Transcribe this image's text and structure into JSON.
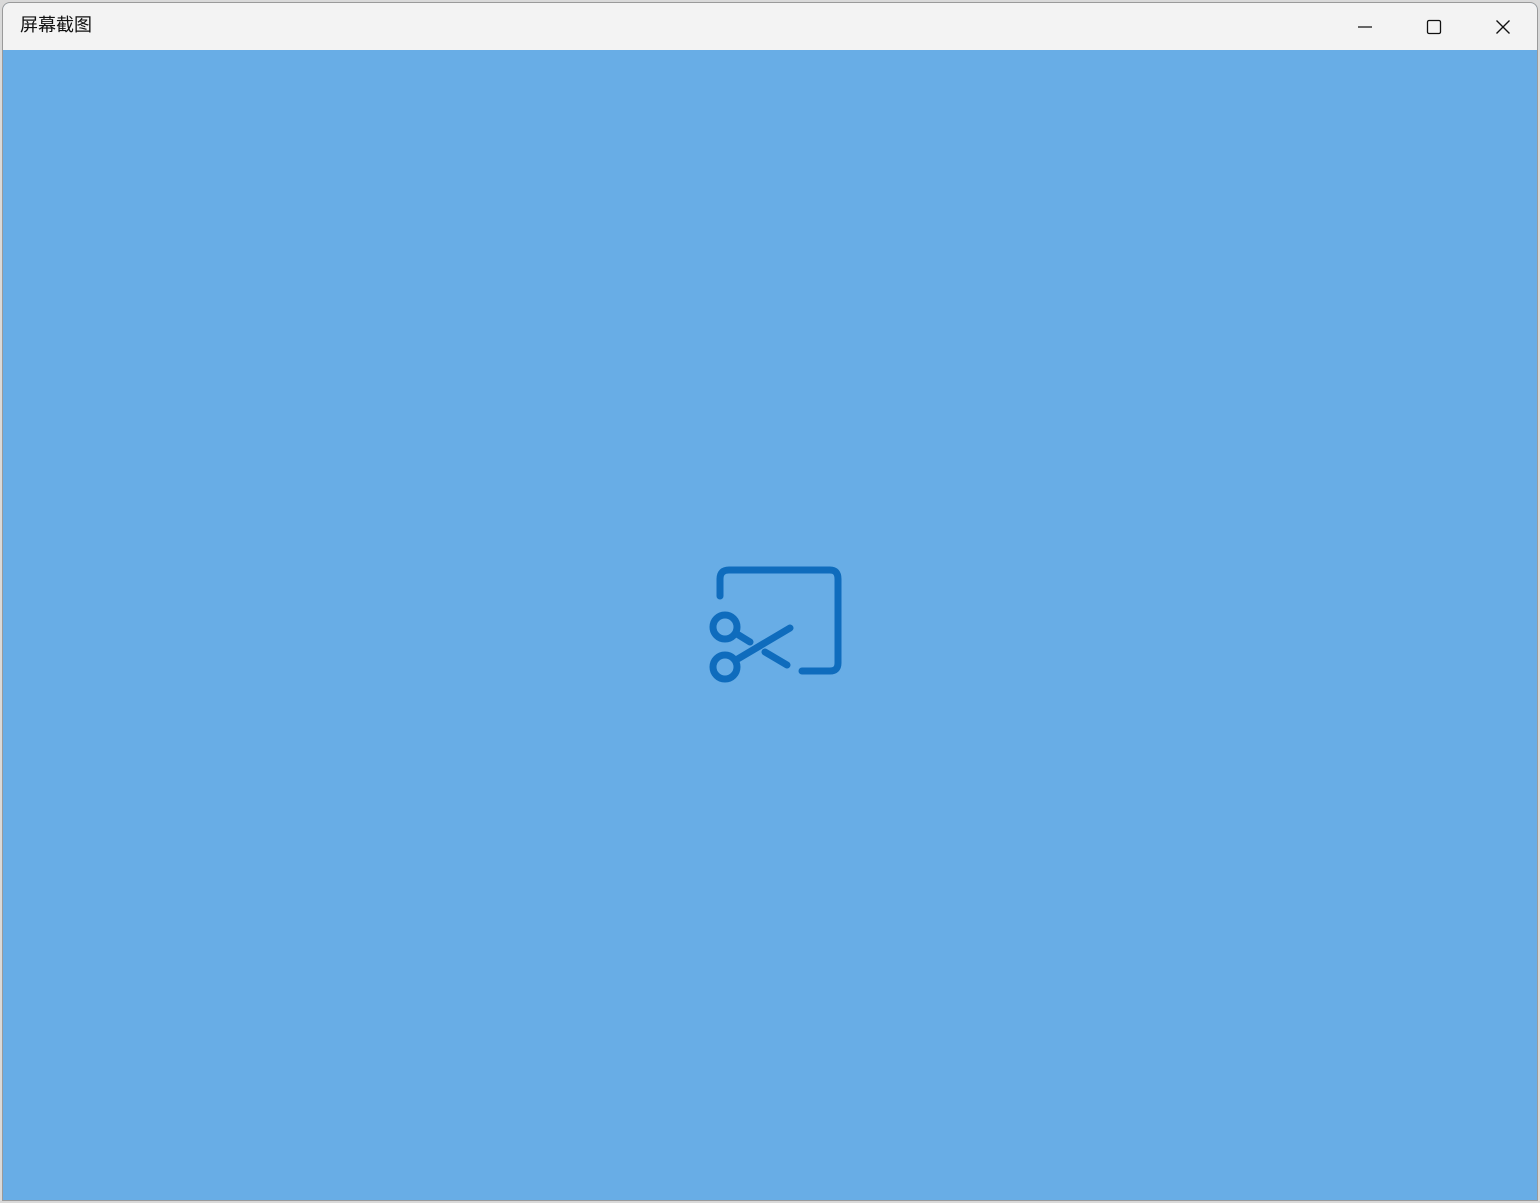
{
  "window": {
    "title": "屏幕截图",
    "background_color": "#68ADE6",
    "titlebar_color": "#F3F3F3",
    "controls": {
      "minimize_icon": "minimize-icon",
      "maximize_icon": "maximize-icon",
      "close_icon": "close-icon"
    }
  },
  "splash": {
    "icon": "snipping-tool-icon",
    "icon_color": "#0F6CBD"
  }
}
